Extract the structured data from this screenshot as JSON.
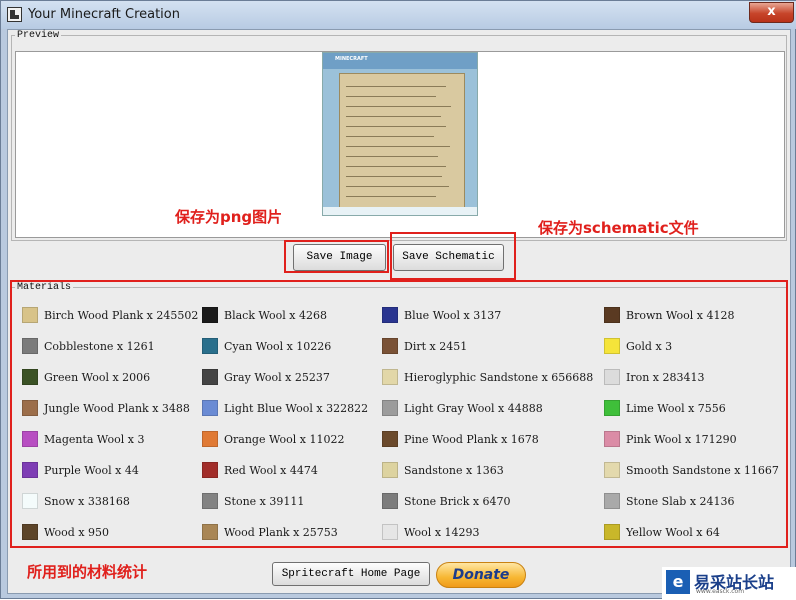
{
  "window": {
    "title": "Your Minecraft Creation",
    "close_label": "x"
  },
  "preview": {
    "legend": "Preview"
  },
  "buttons": {
    "save_image": "Save Image",
    "save_schematic": "Save Schematic",
    "home_page": "Spritecraft Home Page",
    "donate": "Donate"
  },
  "annotations": {
    "save_png": "保存为png图片",
    "save_schematic": "保存为schematic文件",
    "materials_stats": "所用到的材料统计"
  },
  "materials": {
    "legend": "Materials",
    "items": [
      {
        "label": "Birch Wood Plank x 245502",
        "color": "#d8c389"
      },
      {
        "label": "Black Wool x 4268",
        "color": "#1b1b1b"
      },
      {
        "label": "Blue Wool x 3137",
        "color": "#2a3590"
      },
      {
        "label": "Brown Wool x 4128",
        "color": "#5a3a22"
      },
      {
        "label": "Cobblestone x 1261",
        "color": "#7b7b7b"
      },
      {
        "label": "Cyan Wool x 10226",
        "color": "#2a6f8c"
      },
      {
        "label": "Dirt x 2451",
        "color": "#7a5236"
      },
      {
        "label": "Gold x 3",
        "color": "#f5e43a"
      },
      {
        "label": "Green Wool x 2006",
        "color": "#3b5225"
      },
      {
        "label": "Gray Wool x 25237",
        "color": "#444444"
      },
      {
        "label": "Hieroglyphic Sandstone x 656688",
        "color": "#e2d7a8"
      },
      {
        "label": "Iron x 283413",
        "color": "#dcdcdc"
      },
      {
        "label": "Jungle Wood Plank x 3488",
        "color": "#9c6e4a"
      },
      {
        "label": "Light Blue Wool x 322822",
        "color": "#6a8bd4"
      },
      {
        "label": "Light Gray Wool x 44888",
        "color": "#9c9c9c"
      },
      {
        "label": "Lime Wool x 7556",
        "color": "#3fbf3a"
      },
      {
        "label": "Magenta Wool x 3",
        "color": "#b84fc2"
      },
      {
        "label": "Orange Wool x 11022",
        "color": "#e07a35"
      },
      {
        "label": "Pine Wood Plank x 1678",
        "color": "#6b4a2c"
      },
      {
        "label": "Pink Wool x 171290",
        "color": "#db8ca6"
      },
      {
        "label": "Purple Wool x 44",
        "color": "#7e3db5"
      },
      {
        "label": "Red Wool x 4474",
        "color": "#a12d2a"
      },
      {
        "label": "Sandstone x 1363",
        "color": "#ddd3a0"
      },
      {
        "label": "Smooth Sandstone x 11667",
        "color": "#e3d9ad"
      },
      {
        "label": "Snow x 338168",
        "color": "#f4fbfb"
      },
      {
        "label": "Stone x 39111",
        "color": "#838383"
      },
      {
        "label": "Stone Brick x 6470",
        "color": "#7c7c7c"
      },
      {
        "label": "Stone Slab x 24136",
        "color": "#a9a9a9"
      },
      {
        "label": "Wood x 950",
        "color": "#5c4428"
      },
      {
        "label": "Wood Plank x 25753",
        "color": "#a98655"
      },
      {
        "label": "Wool x 14293",
        "color": "#e6e6e6"
      },
      {
        "label": "Yellow Wool x 64",
        "color": "#c9b72a"
      }
    ]
  },
  "watermark": {
    "logo": "e",
    "text": "易采站长站",
    "sub": "www.easck.com"
  }
}
